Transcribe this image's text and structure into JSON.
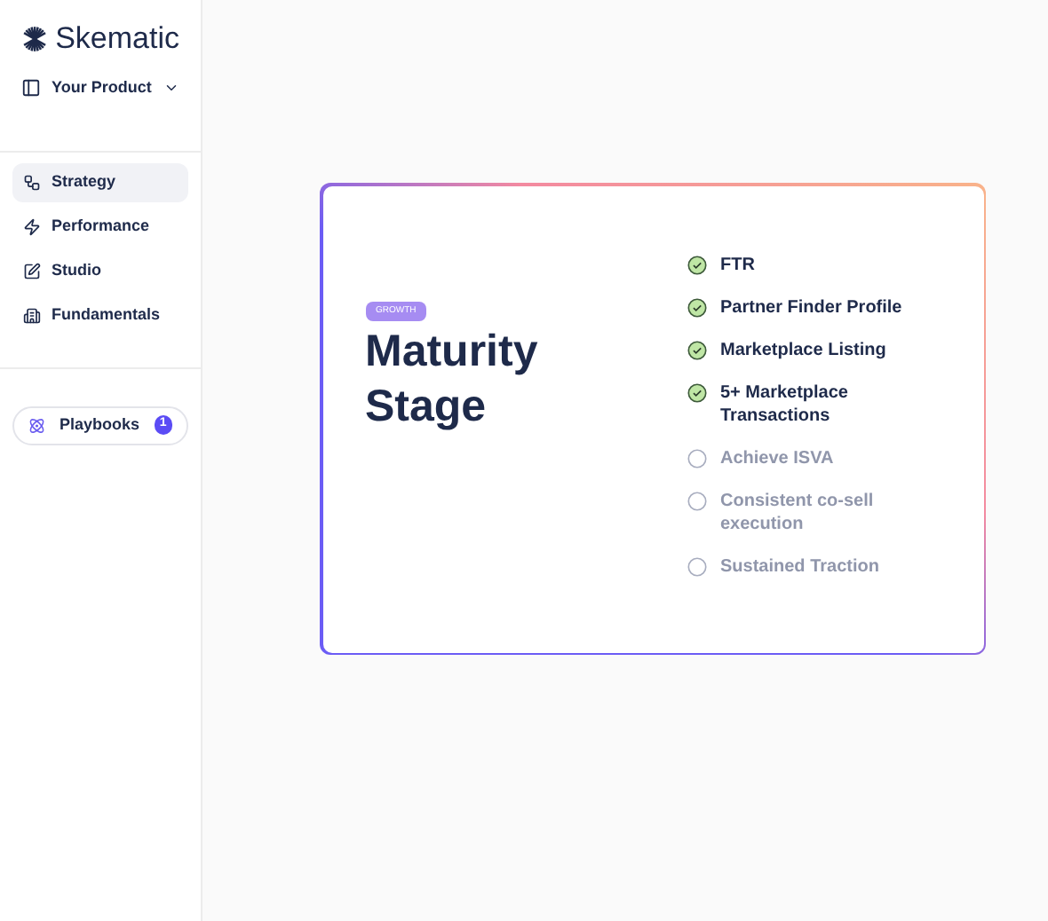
{
  "brand": {
    "name": "Skematic"
  },
  "product_selector": {
    "label": "Your Product"
  },
  "nav": [
    {
      "label": "Strategy",
      "selected": true
    },
    {
      "label": "Performance",
      "selected": false
    },
    {
      "label": "Studio",
      "selected": false
    },
    {
      "label": "Fundamentals",
      "selected": false
    }
  ],
  "playbooks": {
    "label": "Playbooks",
    "count": "1"
  },
  "card": {
    "badge": "GROWTH",
    "title": "Maturity Stage",
    "milestones": [
      {
        "label": "FTR",
        "checked": true
      },
      {
        "label": "Partner Finder Profile",
        "checked": true
      },
      {
        "label": "Marketplace Listing",
        "checked": true
      },
      {
        "label": "5+ Marketplace Transactions",
        "checked": true
      },
      {
        "label": "Achieve ISVA",
        "checked": false
      },
      {
        "label": "Consistent co-sell execution",
        "checked": false
      },
      {
        "label": "Sustained Traction",
        "checked": false
      }
    ]
  }
}
